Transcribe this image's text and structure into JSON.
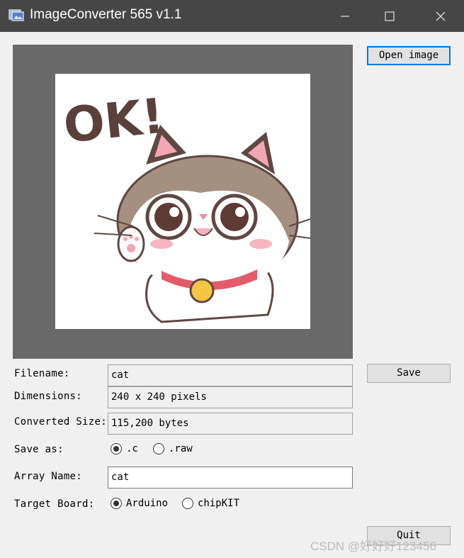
{
  "window": {
    "title": "ImageConverter 565 v1.1"
  },
  "buttons": {
    "open": "Open image",
    "save": "Save",
    "quit": "Quit"
  },
  "image": {
    "overlay_text": "OK!"
  },
  "form": {
    "filename_label": "Filename:",
    "filename_value": "cat",
    "dimensions_label": "Dimensions:",
    "dimensions_value": "240 x 240 pixels",
    "converted_label": "Converted Size:",
    "converted_value": "115,200 bytes",
    "save_as_label": "Save as:",
    "save_as_options": [
      ".c",
      ".raw"
    ],
    "save_as_selected": ".c",
    "array_name_label": "Array Name:",
    "array_name_value": "cat",
    "target_board_label": "Target Board:",
    "target_board_options": [
      "Arduino",
      "chipKIT"
    ],
    "target_board_selected": "Arduino"
  },
  "watermark": "CSDN @好好好123456",
  "colors": {
    "titlebar": "#464646",
    "preview_bg": "#696969",
    "accent": "#0078d7"
  }
}
